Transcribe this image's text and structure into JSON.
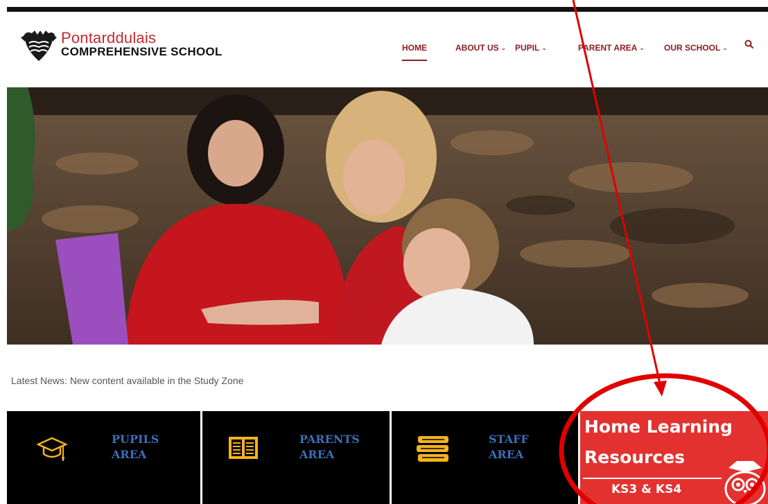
{
  "site": {
    "name": "Pontarddulais",
    "subtitle": "COMPREHENSIVE SCHOOL"
  },
  "nav": {
    "items": [
      {
        "label": "HOME",
        "active": true,
        "has_dropdown": false
      },
      {
        "label": "ABOUT US",
        "active": false,
        "has_dropdown": true
      },
      {
        "label": "PUPIL",
        "active": false,
        "has_dropdown": true
      },
      {
        "label": "PARENT AREA",
        "active": false,
        "has_dropdown": true
      },
      {
        "label": "OUR SCHOOL",
        "active": false,
        "has_dropdown": true
      }
    ],
    "search_icon": "search-icon"
  },
  "news": {
    "text": "Latest News: New content available in the Study Zone"
  },
  "tiles": [
    {
      "line1": "PUPILS",
      "line2": "AREA",
      "icon": "graduation-cap-icon"
    },
    {
      "line1": "PARENTS",
      "line2": "AREA",
      "icon": "open-book-icon"
    },
    {
      "line1": "STAFF",
      "line2": "AREA",
      "icon": "book-stack-icon"
    }
  ],
  "home_learning": {
    "line1": "Home Learning",
    "line2": "Resources",
    "line3": "KS3 & KS4",
    "icon": "owl-icon"
  },
  "colors": {
    "brand_red": "#c8272e",
    "nav_text": "#8b1e24",
    "tile_bg": "#000000",
    "tile_text": "#3b6fb8",
    "icon_gold": "#f2b31c",
    "home_learning_bg": "#e3312f",
    "annotation_red": "#e00000"
  }
}
